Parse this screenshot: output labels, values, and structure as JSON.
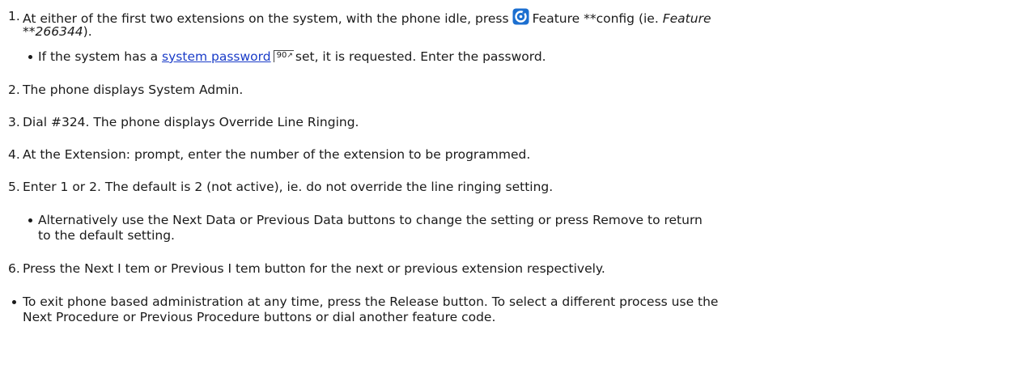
{
  "steps": {
    "s1": {
      "num": "1.",
      "pre": "At either of the first two extensions on the system, with the phone idle, press",
      "icon": "feature-button-icon",
      "mid": "Feature **config (ie.",
      "ital1": "Feature",
      "ital2": "**266344",
      "post": ")."
    },
    "s1_bullet": {
      "pre": "If the system has a",
      "link": "system password",
      "ref": "90",
      "post": "set, it is requested. Enter the password."
    },
    "s2": {
      "num": "2.",
      "text": "The phone displays System Admin."
    },
    "s3": {
      "num": "3.",
      "text": "Dial #324. The phone displays Override Line Ringing."
    },
    "s4": {
      "num": "4.",
      "text": "At the Extension: prompt, enter the number of the extension to be programmed."
    },
    "s5": {
      "num": "5.",
      "text": "Enter 1 or 2. The default is 2 (not active), ie. do not override the line ringing setting."
    },
    "s5_bullet": {
      "line1": "Alternatively use the Next Data or Previous Data buttons to change the setting or press Remove to return",
      "line2": "to the default setting."
    },
    "s6": {
      "num": "6.",
      "text": "Press the Next I tem or Previous I tem button for the next or previous extension respectively."
    }
  },
  "note": {
    "line1": "To exit phone based administration at any time, press the Release button. To select a different process use the",
    "line2": "Next Procedure or Previous Procedure buttons or dial another feature code."
  },
  "colors": {
    "link": "#1a3cc8",
    "icon_blue": "#1c6fd0",
    "text": "#1a1a1a"
  }
}
